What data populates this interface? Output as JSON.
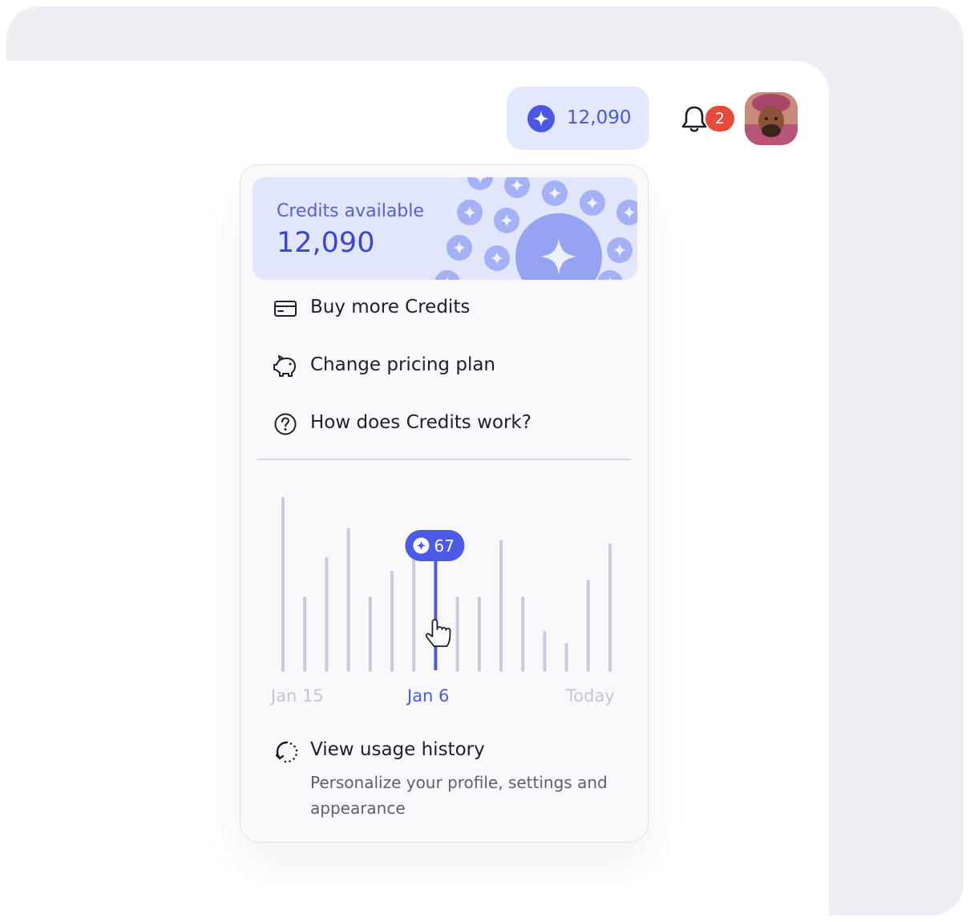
{
  "header": {
    "credits_balance": "12,090",
    "notifications_count": "2",
    "icons": [
      "sparkle-icon",
      "bell-icon",
      "avatar"
    ]
  },
  "panel": {
    "credits_label": "Credits available",
    "credits_value": "12,090",
    "menu": [
      {
        "label": "Buy more Credits",
        "icon": "credit-card-icon"
      },
      {
        "label": "Change pricing plan",
        "icon": "piggy-bank-icon"
      },
      {
        "label": "How does Credits work?",
        "icon": "help-circle-icon"
      }
    ],
    "history_title": "View usage history",
    "history_desc": "Personalize your profile, settings and appearance"
  },
  "chart_data": {
    "type": "bar",
    "x_labels": [
      "Jan 15",
      "Jan 6",
      "Today"
    ],
    "values": [
      100,
      42,
      65,
      82,
      42,
      57,
      65,
      67,
      42,
      42,
      75,
      42,
      22,
      15,
      52,
      73
    ],
    "selected_index": 7,
    "tooltip": "67",
    "colors": {
      "bar": "#c9cadb",
      "selected": "#4c5ae8"
    }
  }
}
